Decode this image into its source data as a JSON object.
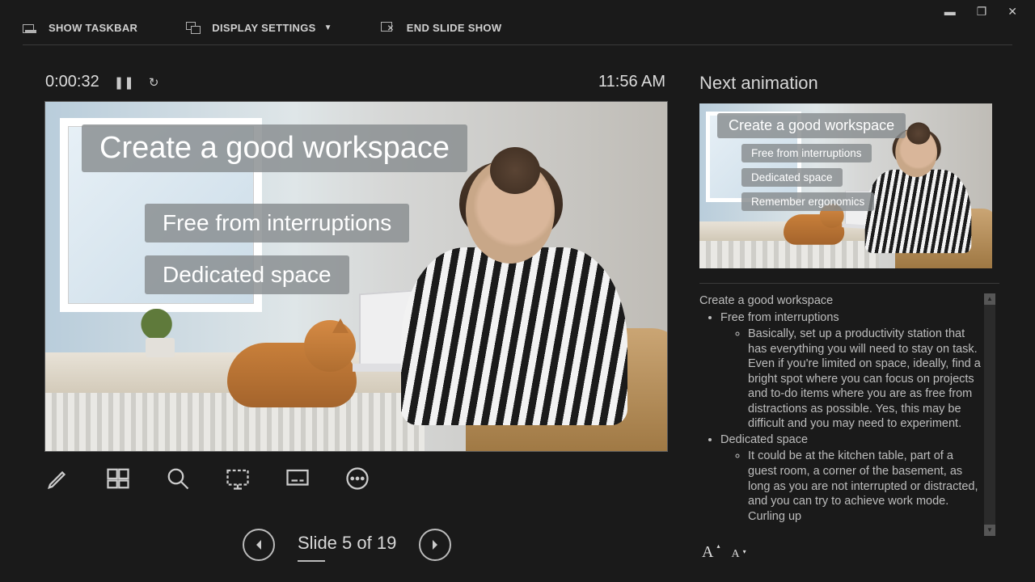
{
  "window_controls": {
    "min": "▬",
    "restore": "❐",
    "close": "✕"
  },
  "topbar": {
    "show_taskbar": "SHOW TASKBAR",
    "display_settings": "DISPLAY SETTINGS",
    "dropdown_glyph": "▼",
    "end_slideshow": "END SLIDE SHOW"
  },
  "timer": {
    "elapsed": "0:00:32",
    "pause_glyph": "❚❚",
    "reset_glyph": "↻"
  },
  "clock": "11:56 AM",
  "current_slide": {
    "title": "Create a good workspace",
    "bullets": [
      "Free from interruptions",
      "Dedicated space"
    ]
  },
  "next_panel": {
    "label": "Next animation",
    "title": "Create a good workspace",
    "bullets": [
      "Free from interruptions",
      "Dedicated space",
      "Remember ergonomics"
    ]
  },
  "notes": {
    "heading": "Create a good workspace",
    "items": [
      {
        "label": "Free from interruptions",
        "sub": "Basically, set up a productivity station that has everything you will need to stay on task. Even if you're limited on space, ideally, find a bright spot where you can focus on projects and to-do items where you are as free from distractions as possible. Yes, this may be difficult and you may need to experiment."
      },
      {
        "label": "Dedicated space",
        "sub": "It could be at the kitchen table, part of a guest room, a corner of the basement, as long as you are not interrupted or distracted, and you can try to achieve work mode. Curling up"
      }
    ]
  },
  "slide_nav": {
    "label": "Slide 5 of 19"
  },
  "fontsize": {
    "big": "A",
    "small": "A"
  }
}
